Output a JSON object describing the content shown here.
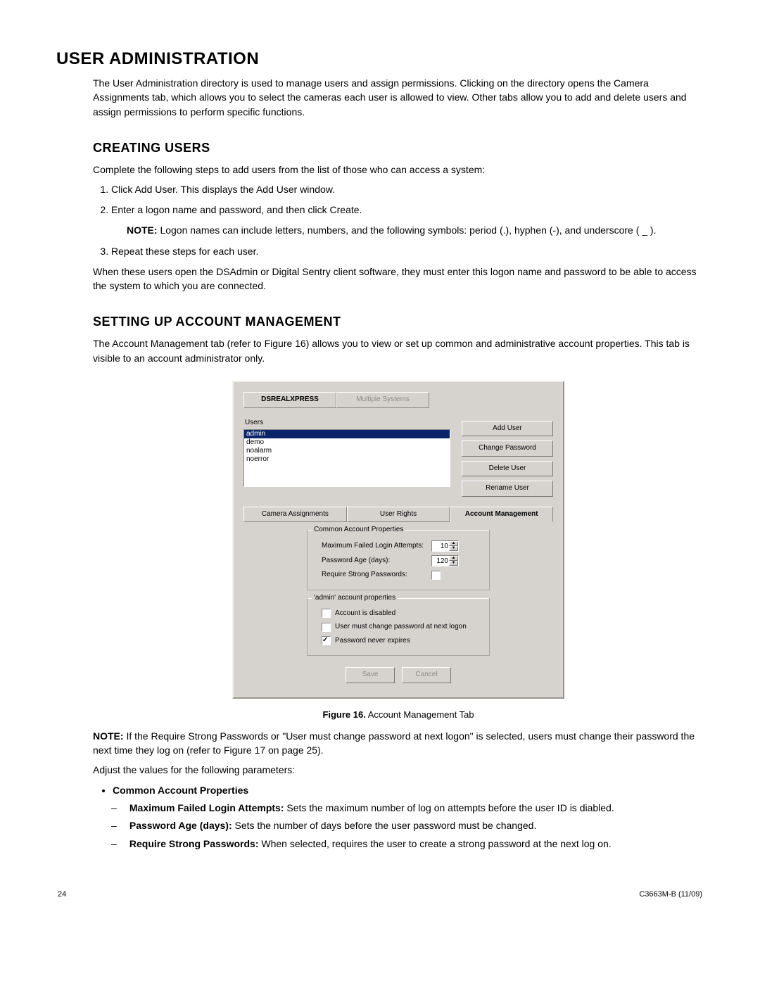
{
  "h1": "USER ADMINISTRATION",
  "intro": "The User Administration directory is used to manage users and assign permissions. Clicking on the directory opens the Camera Assignments tab, which allows you to select the cameras each user is allowed to view. Other tabs allow you to add and delete users and assign permissions to perform specific functions.",
  "h2a": "CREATING USERS",
  "stepsIntro": "Complete the following steps to add users from the list of those who can access a system:",
  "step1": "Click Add User. This displays the Add User window.",
  "step2": "Enter a logon name and password, and then click Create.",
  "noteLabel": "NOTE:",
  "step2note": "  Logon names can include letters, numbers, and the following symbols: period (.), hyphen (-), and underscore ( _ ).",
  "step3": "Repeat these steps for each user.",
  "afterSteps": "When these users open the DSAdmin or Digital Sentry client software, they must enter this logon name and password to be able to access the system to which you are connected.",
  "h2b": "SETTING UP ACCOUNT MANAGEMENT",
  "acctIntro": "The Account Management tab (refer to Figure 16) allows you to view or set up common and administrative account properties. This tab is visible to an account administrator only.",
  "figure": {
    "label": "Figure 16.",
    "caption": "  Account Management Tab"
  },
  "ui": {
    "connTabs": {
      "active": "DSREALXPRESS",
      "inactive": "Multiple Systems"
    },
    "usersLabel": "Users",
    "users": [
      "admin",
      "demo",
      "noalarm",
      "noerror"
    ],
    "selectedIndex": 0,
    "buttons": {
      "addUser": "Add User",
      "changePw": "Change Password",
      "deleteUser": "Delete User",
      "renameUser": "Rename User"
    },
    "tabs": {
      "cam": "Camera Assignments",
      "rights": "User Rights",
      "acct": "Account Management"
    },
    "common": {
      "legend": "Common Account Properties",
      "maxFailLabel": "Maximum Failed Login Attempts:",
      "maxFailValue": "10",
      "pwAgeLabel": "Password Age (days):",
      "pwAgeValue": "120",
      "strongLabel": "Require Strong Passwords:"
    },
    "admin": {
      "legend": "'admin' account properties",
      "disabledLabel": "Account is disabled",
      "mustChangeLabel": "User must change password at next logon",
      "neverExpiresLabel": "Password never expires"
    },
    "save": "Save",
    "cancel": "Cancel"
  },
  "note2": "  If the Require Strong Passwords or \"User must change password at next logon\" is selected, users must change their password the next time they log on (refer to Figure 17 on page 25).",
  "adjust": "Adjust the values for the following parameters:",
  "bulletHead": "Common Account Properties",
  "sub1head": "Maximum Failed Login Attempts:",
  "sub1text": "  Sets the maximum number of log on attempts before the user ID is diabled.",
  "sub2head": "Password Age (days):",
  "sub2text": "  Sets the number of days before the user password must be changed.",
  "sub3head": "Require Strong Passwords:",
  "sub3text": "  When selected, requires the user to create a strong password at the next log on.",
  "footer": {
    "page": "24",
    "doc": "C3663M-B (11/09)"
  }
}
